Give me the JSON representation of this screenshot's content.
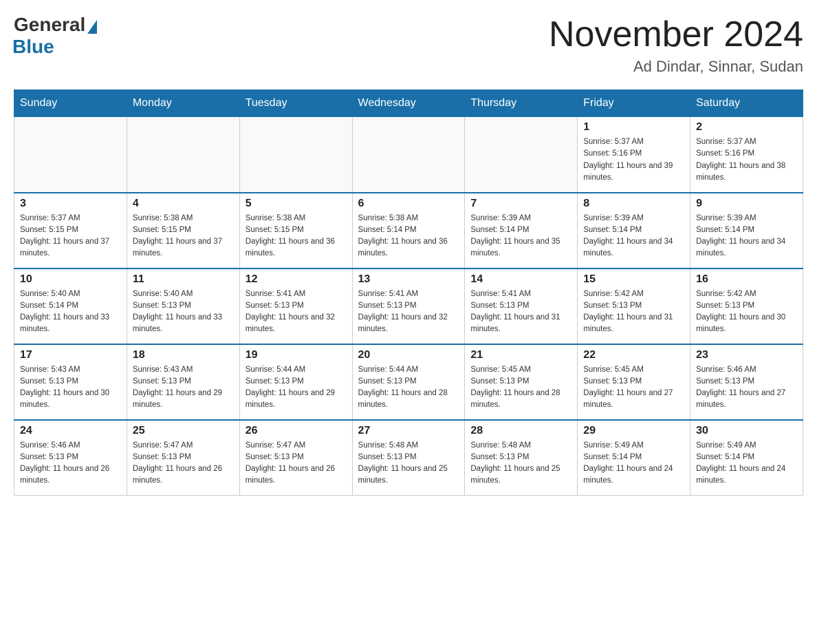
{
  "header": {
    "logo_general": "General",
    "logo_blue": "Blue",
    "month_title": "November 2024",
    "location": "Ad Dindar, Sinnar, Sudan"
  },
  "days_of_week": [
    "Sunday",
    "Monday",
    "Tuesday",
    "Wednesday",
    "Thursday",
    "Friday",
    "Saturday"
  ],
  "weeks": [
    [
      {
        "day": "",
        "sunrise": "",
        "sunset": "",
        "daylight": ""
      },
      {
        "day": "",
        "sunrise": "",
        "sunset": "",
        "daylight": ""
      },
      {
        "day": "",
        "sunrise": "",
        "sunset": "",
        "daylight": ""
      },
      {
        "day": "",
        "sunrise": "",
        "sunset": "",
        "daylight": ""
      },
      {
        "day": "",
        "sunrise": "",
        "sunset": "",
        "daylight": ""
      },
      {
        "day": "1",
        "sunrise": "Sunrise: 5:37 AM",
        "sunset": "Sunset: 5:16 PM",
        "daylight": "Daylight: 11 hours and 39 minutes."
      },
      {
        "day": "2",
        "sunrise": "Sunrise: 5:37 AM",
        "sunset": "Sunset: 5:16 PM",
        "daylight": "Daylight: 11 hours and 38 minutes."
      }
    ],
    [
      {
        "day": "3",
        "sunrise": "Sunrise: 5:37 AM",
        "sunset": "Sunset: 5:15 PM",
        "daylight": "Daylight: 11 hours and 37 minutes."
      },
      {
        "day": "4",
        "sunrise": "Sunrise: 5:38 AM",
        "sunset": "Sunset: 5:15 PM",
        "daylight": "Daylight: 11 hours and 37 minutes."
      },
      {
        "day": "5",
        "sunrise": "Sunrise: 5:38 AM",
        "sunset": "Sunset: 5:15 PM",
        "daylight": "Daylight: 11 hours and 36 minutes."
      },
      {
        "day": "6",
        "sunrise": "Sunrise: 5:38 AM",
        "sunset": "Sunset: 5:14 PM",
        "daylight": "Daylight: 11 hours and 36 minutes."
      },
      {
        "day": "7",
        "sunrise": "Sunrise: 5:39 AM",
        "sunset": "Sunset: 5:14 PM",
        "daylight": "Daylight: 11 hours and 35 minutes."
      },
      {
        "day": "8",
        "sunrise": "Sunrise: 5:39 AM",
        "sunset": "Sunset: 5:14 PM",
        "daylight": "Daylight: 11 hours and 34 minutes."
      },
      {
        "day": "9",
        "sunrise": "Sunrise: 5:39 AM",
        "sunset": "Sunset: 5:14 PM",
        "daylight": "Daylight: 11 hours and 34 minutes."
      }
    ],
    [
      {
        "day": "10",
        "sunrise": "Sunrise: 5:40 AM",
        "sunset": "Sunset: 5:14 PM",
        "daylight": "Daylight: 11 hours and 33 minutes."
      },
      {
        "day": "11",
        "sunrise": "Sunrise: 5:40 AM",
        "sunset": "Sunset: 5:13 PM",
        "daylight": "Daylight: 11 hours and 33 minutes."
      },
      {
        "day": "12",
        "sunrise": "Sunrise: 5:41 AM",
        "sunset": "Sunset: 5:13 PM",
        "daylight": "Daylight: 11 hours and 32 minutes."
      },
      {
        "day": "13",
        "sunrise": "Sunrise: 5:41 AM",
        "sunset": "Sunset: 5:13 PM",
        "daylight": "Daylight: 11 hours and 32 minutes."
      },
      {
        "day": "14",
        "sunrise": "Sunrise: 5:41 AM",
        "sunset": "Sunset: 5:13 PM",
        "daylight": "Daylight: 11 hours and 31 minutes."
      },
      {
        "day": "15",
        "sunrise": "Sunrise: 5:42 AM",
        "sunset": "Sunset: 5:13 PM",
        "daylight": "Daylight: 11 hours and 31 minutes."
      },
      {
        "day": "16",
        "sunrise": "Sunrise: 5:42 AM",
        "sunset": "Sunset: 5:13 PM",
        "daylight": "Daylight: 11 hours and 30 minutes."
      }
    ],
    [
      {
        "day": "17",
        "sunrise": "Sunrise: 5:43 AM",
        "sunset": "Sunset: 5:13 PM",
        "daylight": "Daylight: 11 hours and 30 minutes."
      },
      {
        "day": "18",
        "sunrise": "Sunrise: 5:43 AM",
        "sunset": "Sunset: 5:13 PM",
        "daylight": "Daylight: 11 hours and 29 minutes."
      },
      {
        "day": "19",
        "sunrise": "Sunrise: 5:44 AM",
        "sunset": "Sunset: 5:13 PM",
        "daylight": "Daylight: 11 hours and 29 minutes."
      },
      {
        "day": "20",
        "sunrise": "Sunrise: 5:44 AM",
        "sunset": "Sunset: 5:13 PM",
        "daylight": "Daylight: 11 hours and 28 minutes."
      },
      {
        "day": "21",
        "sunrise": "Sunrise: 5:45 AM",
        "sunset": "Sunset: 5:13 PM",
        "daylight": "Daylight: 11 hours and 28 minutes."
      },
      {
        "day": "22",
        "sunrise": "Sunrise: 5:45 AM",
        "sunset": "Sunset: 5:13 PM",
        "daylight": "Daylight: 11 hours and 27 minutes."
      },
      {
        "day": "23",
        "sunrise": "Sunrise: 5:46 AM",
        "sunset": "Sunset: 5:13 PM",
        "daylight": "Daylight: 11 hours and 27 minutes."
      }
    ],
    [
      {
        "day": "24",
        "sunrise": "Sunrise: 5:46 AM",
        "sunset": "Sunset: 5:13 PM",
        "daylight": "Daylight: 11 hours and 26 minutes."
      },
      {
        "day": "25",
        "sunrise": "Sunrise: 5:47 AM",
        "sunset": "Sunset: 5:13 PM",
        "daylight": "Daylight: 11 hours and 26 minutes."
      },
      {
        "day": "26",
        "sunrise": "Sunrise: 5:47 AM",
        "sunset": "Sunset: 5:13 PM",
        "daylight": "Daylight: 11 hours and 26 minutes."
      },
      {
        "day": "27",
        "sunrise": "Sunrise: 5:48 AM",
        "sunset": "Sunset: 5:13 PM",
        "daylight": "Daylight: 11 hours and 25 minutes."
      },
      {
        "day": "28",
        "sunrise": "Sunrise: 5:48 AM",
        "sunset": "Sunset: 5:13 PM",
        "daylight": "Daylight: 11 hours and 25 minutes."
      },
      {
        "day": "29",
        "sunrise": "Sunrise: 5:49 AM",
        "sunset": "Sunset: 5:14 PM",
        "daylight": "Daylight: 11 hours and 24 minutes."
      },
      {
        "day": "30",
        "sunrise": "Sunrise: 5:49 AM",
        "sunset": "Sunset: 5:14 PM",
        "daylight": "Daylight: 11 hours and 24 minutes."
      }
    ]
  ]
}
